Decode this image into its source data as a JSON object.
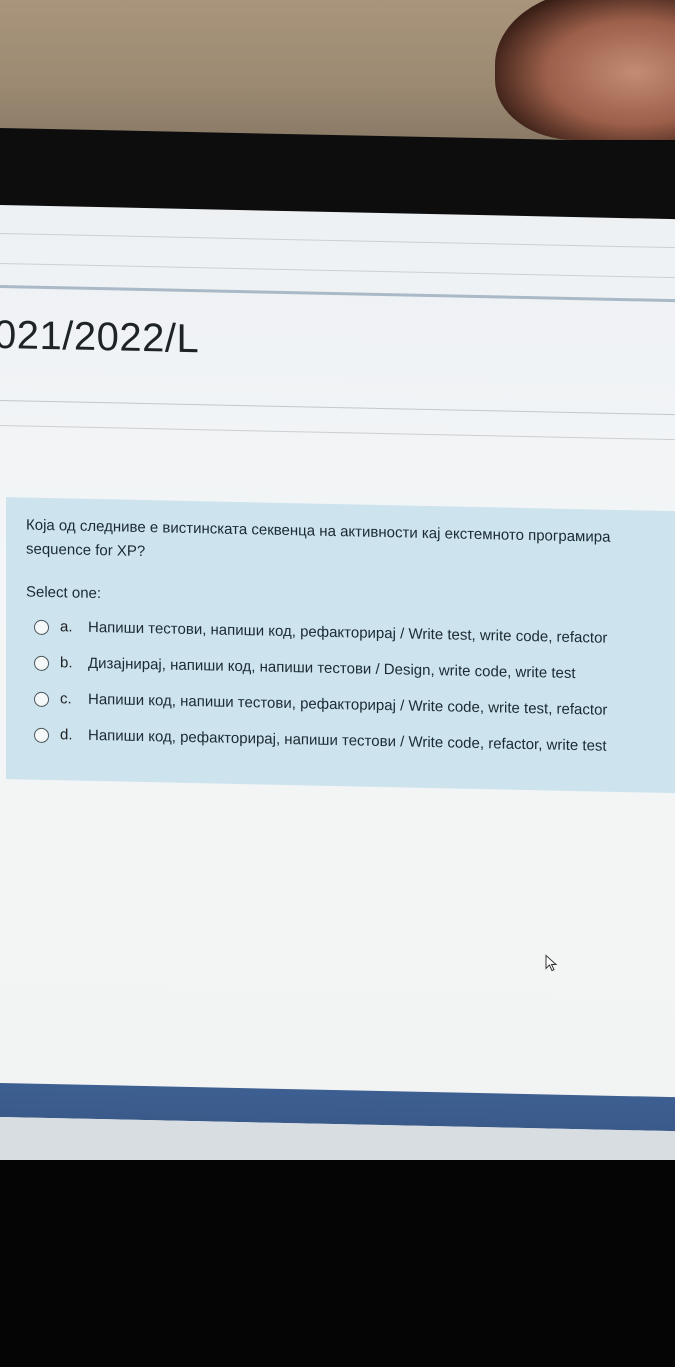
{
  "course": {
    "title": "021/2022/L"
  },
  "question": {
    "text_line1": "Која од следниве е вистинската секвенца на активности кај екстемното програмира",
    "text_line2": "sequence for XP?",
    "prompt": "Select one:",
    "options": [
      {
        "letter": "a.",
        "text": "Напиши тестови, напиши код, рефакторирај / Write test, write code, refactor"
      },
      {
        "letter": "b.",
        "text": "Дизајнирај, напиши код, напиши тестови / Design, write code, write test"
      },
      {
        "letter": "c.",
        "text": "Напиши код, напиши тестови, рефакторирај / Write code, write test, refactor"
      },
      {
        "letter": "d.",
        "text": "Напиши код, рефакторирај, напиши тестови / Write code, refactor, write test"
      }
    ]
  },
  "colors": {
    "question_background": "#cde4ef",
    "footer_bar": "#3a5a8a"
  }
}
